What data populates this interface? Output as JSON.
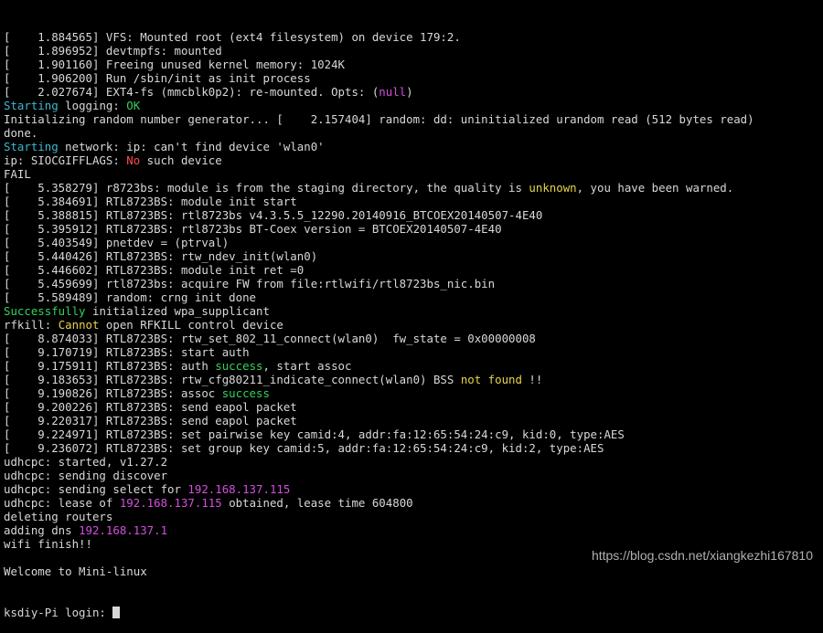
{
  "colors": {
    "background": "#000000",
    "text": "#d8d8d8",
    "teal": "#3eb8d0",
    "green": "#33d15a",
    "yellow": "#e6d34a",
    "red": "#ff4b4b",
    "magenta": "#d44fe0"
  },
  "lines": [
    [
      {
        "t": "[    1.884565] VFS: Mounted root (ext4 filesystem) on device 179:2."
      }
    ],
    [
      {
        "t": "[    1.896952] devtmpfs: mounted"
      }
    ],
    [
      {
        "t": "[    1.901160] Freeing unused kernel memory: 1024K"
      }
    ],
    [
      {
        "t": "[    1.906200] Run /sbin/init as init process"
      }
    ],
    [
      {
        "t": "[    2.027674] EXT4-fs (mmcblk0p2): re-mounted. Opts: ("
      },
      {
        "t": "null",
        "c": "magenta"
      },
      {
        "t": ")"
      }
    ],
    [
      {
        "t": "Starting",
        "c": "teal"
      },
      {
        "t": " logging: "
      },
      {
        "t": "OK",
        "c": "green"
      }
    ],
    [
      {
        "t": "Initializing random number generator... [    2.157404] random: dd: uninitialized urandom read (512 bytes read)"
      }
    ],
    [
      {
        "t": "done."
      }
    ],
    [
      {
        "t": "Starting",
        "c": "teal"
      },
      {
        "t": " network: ip: can't find device 'wlan0'"
      }
    ],
    [
      {
        "t": "ip: SIOCGIFFLAGS: "
      },
      {
        "t": "No",
        "c": "red"
      },
      {
        "t": " such device"
      }
    ],
    [
      {
        "t": "FAIL"
      }
    ],
    [
      {
        "t": "[    5.358279] r8723bs: module is from the staging directory, the quality is "
      },
      {
        "t": "unknown",
        "c": "yellow"
      },
      {
        "t": ", you have been warned."
      }
    ],
    [
      {
        "t": "[    5.384691] RTL8723BS: module init start"
      }
    ],
    [
      {
        "t": "[    5.388815] RTL8723BS: rtl8723bs v4.3.5.5_12290.20140916_BTCOEX20140507-4E40"
      }
    ],
    [
      {
        "t": "[    5.395912] RTL8723BS: rtl8723bs BT-Coex version = BTCOEX20140507-4E40"
      }
    ],
    [
      {
        "t": "[    5.403549] pnetdev = (ptrval)"
      }
    ],
    [
      {
        "t": "[    5.440426] RTL8723BS: rtw_ndev_init(wlan0)"
      }
    ],
    [
      {
        "t": "[    5.446602] RTL8723BS: module init ret =0"
      }
    ],
    [
      {
        "t": "[    5.459699] rtl8723bs: acquire FW from file:rtlwifi/rtl8723bs_nic.bin"
      }
    ],
    [
      {
        "t": "[    5.589489] random: crng init done"
      }
    ],
    [
      {
        "t": "Successfully",
        "c": "green"
      },
      {
        "t": " initialized wpa_supplicant"
      }
    ],
    [
      {
        "t": "rfkill: "
      },
      {
        "t": "Cannot",
        "c": "yellow"
      },
      {
        "t": " open RFKILL control device"
      }
    ],
    [
      {
        "t": "[    8.874033] RTL8723BS: rtw_set_802_11_connect(wlan0)  fw_state = 0x00000008"
      }
    ],
    [
      {
        "t": "[    9.170719] RTL8723BS: start auth"
      }
    ],
    [
      {
        "t": "[    9.175911] RTL8723BS: auth "
      },
      {
        "t": "success",
        "c": "green"
      },
      {
        "t": ", start assoc"
      }
    ],
    [
      {
        "t": "[    9.183653] RTL8723BS: rtw_cfg80211_indicate_connect(wlan0) BSS "
      },
      {
        "t": "not found",
        "c": "yellow"
      },
      {
        "t": " !!"
      }
    ],
    [
      {
        "t": "[    9.190826] RTL8723BS: assoc "
      },
      {
        "t": "success",
        "c": "green"
      }
    ],
    [
      {
        "t": "[    9.200226] RTL8723BS: send eapol packet"
      }
    ],
    [
      {
        "t": "[    9.220317] RTL8723BS: send eapol packet"
      }
    ],
    [
      {
        "t": "[    9.224971] RTL8723BS: set pairwise key camid:4, addr:fa:12:65:54:24:c9, kid:0, type:AES"
      }
    ],
    [
      {
        "t": "[    9.236072] RTL8723BS: set group key camid:5, addr:fa:12:65:54:24:c9, kid:2, type:AES"
      }
    ],
    [
      {
        "t": "udhcpc: started, v1.27.2"
      }
    ],
    [
      {
        "t": "udhcpc: sending discover"
      }
    ],
    [
      {
        "t": "udhcpc: sending select for "
      },
      {
        "t": "192.168.137.115",
        "c": "magenta"
      }
    ],
    [
      {
        "t": "udhcpc: lease of "
      },
      {
        "t": "192.168.137.115",
        "c": "magenta"
      },
      {
        "t": " obtained, lease time 604800"
      }
    ],
    [
      {
        "t": "deleting routers"
      }
    ],
    [
      {
        "t": "adding dns "
      },
      {
        "t": "192.168.137.1",
        "c": "magenta"
      }
    ],
    [
      {
        "t": "wifi finish!!"
      }
    ],
    [
      {
        "t": ""
      }
    ],
    [
      {
        "t": "Welcome to Mini-linux"
      }
    ]
  ],
  "prompt": {
    "text": "ksdiy-Pi login: "
  },
  "watermark": "https://blog.csdn.net/xiangkezhi167810"
}
